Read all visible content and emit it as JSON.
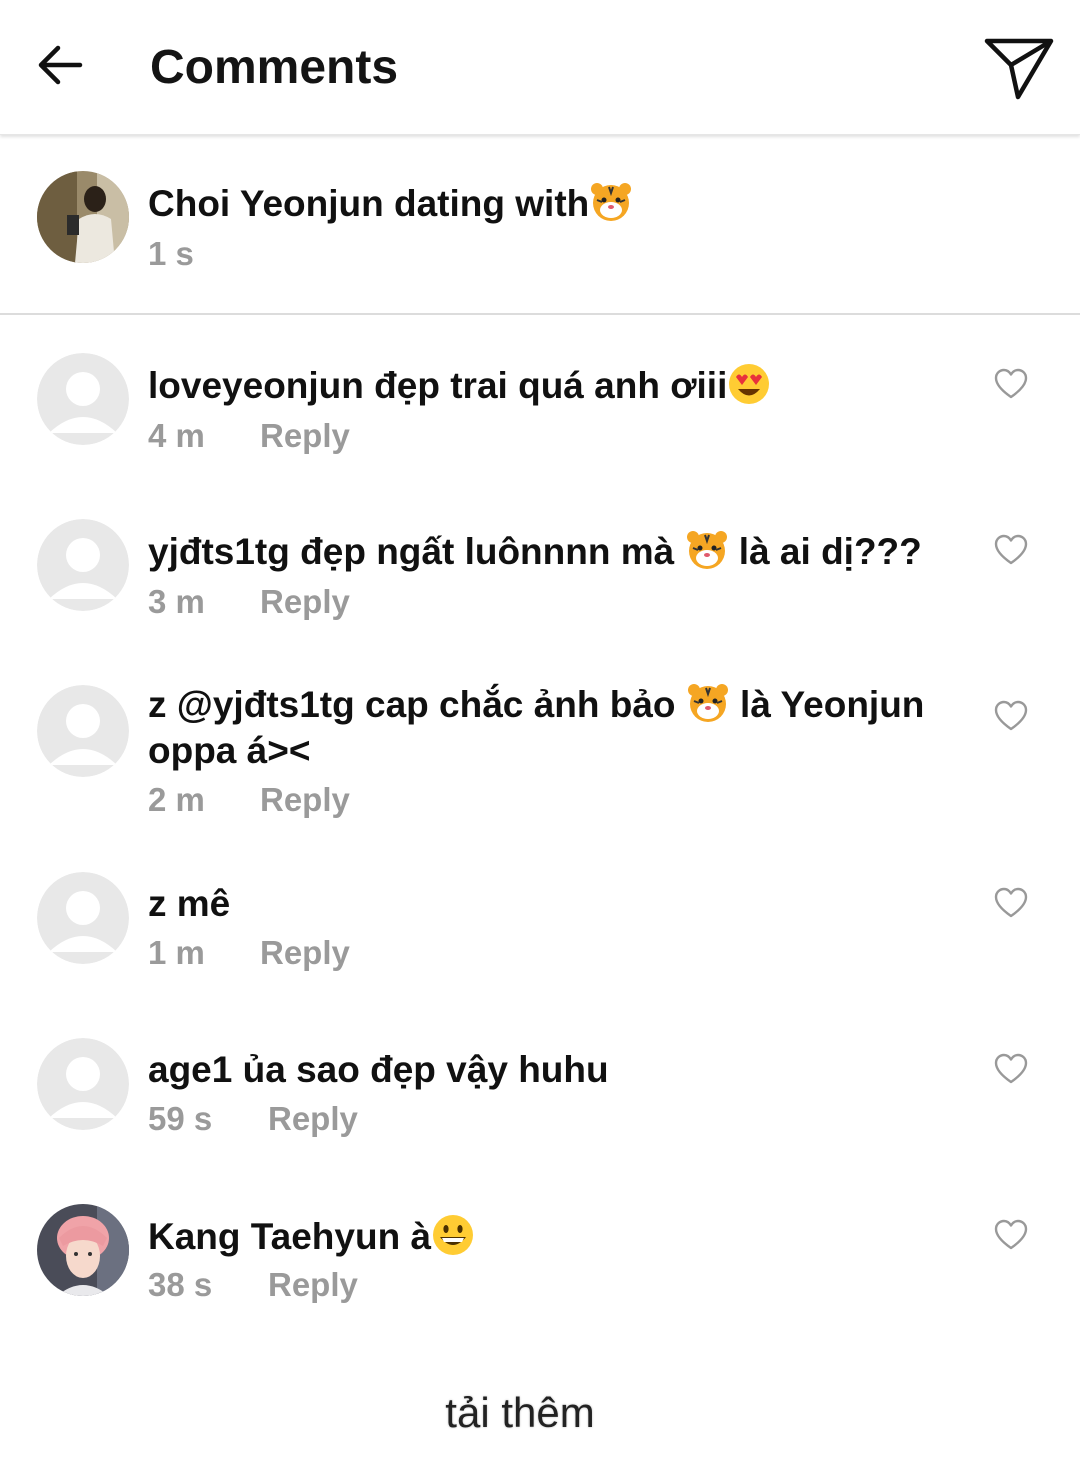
{
  "header": {
    "title": "Comments"
  },
  "caption": {
    "author": "Choi Yeonjun",
    "text": " dating with",
    "emoji": "tiger-emoji",
    "time": "1 s"
  },
  "reply_label": "Reply",
  "comments": [
    {
      "username": "loveyeonjun",
      "text": " đẹp trai quá anh ơiii",
      "emoji_after": "heart-eyes-emoji",
      "time": "4 m"
    },
    {
      "username": "yjđts1tg",
      "text_before": " đẹp ngất luônnnn mà ",
      "emoji_mid": "tiger-emoji",
      "text_after": " là ai dị???",
      "time": "3 m"
    },
    {
      "username": "z",
      "text_before": " @yjđts1tg cap chắc ảnh bảo ",
      "emoji_mid": "tiger-emoji",
      "text_after": " là Yeonjun oppa á><",
      "time": "2 m"
    },
    {
      "username": "z",
      "text": " mê",
      "time": "1 m"
    },
    {
      "username": "age1",
      "text": " ủa sao đẹp vậy huhu",
      "time": "59 s"
    },
    {
      "username": "Kang Taehyun",
      "text": " à",
      "emoji_after": "grinning-emoji",
      "time": "38 s"
    }
  ],
  "load_more": "tải thêm",
  "colors": {
    "meta": "#9a9a9a",
    "text": "#111111",
    "divider": "#dcdcdc"
  }
}
